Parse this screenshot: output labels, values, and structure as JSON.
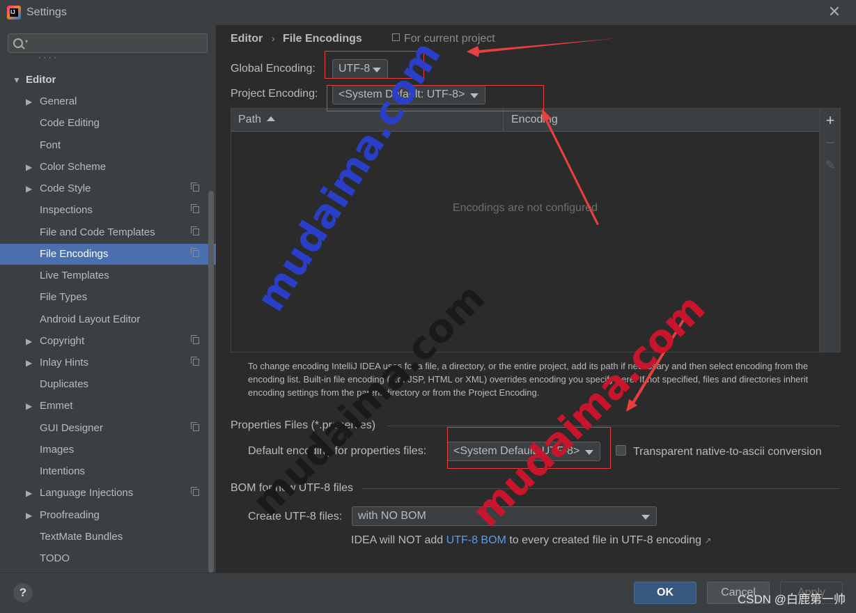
{
  "window": {
    "title": "Settings",
    "close_glyph": "✕"
  },
  "search": {
    "value": "",
    "placeholder": ""
  },
  "sidebar": {
    "partial_item": "· · ·  ·",
    "items": [
      {
        "label": "Editor",
        "level": 0,
        "expand": "open",
        "scoped": false,
        "selected": false
      },
      {
        "label": "General",
        "level": 1,
        "expand": "closed",
        "scoped": false,
        "selected": false
      },
      {
        "label": "Code Editing",
        "level": 1,
        "expand": "none",
        "scoped": false,
        "selected": false
      },
      {
        "label": "Font",
        "level": 1,
        "expand": "none",
        "scoped": false,
        "selected": false
      },
      {
        "label": "Color Scheme",
        "level": 1,
        "expand": "closed",
        "scoped": false,
        "selected": false
      },
      {
        "label": "Code Style",
        "level": 1,
        "expand": "closed",
        "scoped": true,
        "selected": false
      },
      {
        "label": "Inspections",
        "level": 1,
        "expand": "none",
        "scoped": true,
        "selected": false
      },
      {
        "label": "File and Code Templates",
        "level": 1,
        "expand": "none",
        "scoped": true,
        "selected": false
      },
      {
        "label": "File Encodings",
        "level": 1,
        "expand": "none",
        "scoped": true,
        "selected": true
      },
      {
        "label": "Live Templates",
        "level": 1,
        "expand": "none",
        "scoped": false,
        "selected": false
      },
      {
        "label": "File Types",
        "level": 1,
        "expand": "none",
        "scoped": false,
        "selected": false
      },
      {
        "label": "Android Layout Editor",
        "level": 1,
        "expand": "none",
        "scoped": false,
        "selected": false
      },
      {
        "label": "Copyright",
        "level": 1,
        "expand": "closed",
        "scoped": true,
        "selected": false
      },
      {
        "label": "Inlay Hints",
        "level": 1,
        "expand": "closed",
        "scoped": true,
        "selected": false
      },
      {
        "label": "Duplicates",
        "level": 1,
        "expand": "none",
        "scoped": false,
        "selected": false
      },
      {
        "label": "Emmet",
        "level": 1,
        "expand": "closed",
        "scoped": false,
        "selected": false
      },
      {
        "label": "GUI Designer",
        "level": 1,
        "expand": "none",
        "scoped": true,
        "selected": false
      },
      {
        "label": "Images",
        "level": 1,
        "expand": "none",
        "scoped": false,
        "selected": false
      },
      {
        "label": "Intentions",
        "level": 1,
        "expand": "none",
        "scoped": false,
        "selected": false
      },
      {
        "label": "Language Injections",
        "level": 1,
        "expand": "closed",
        "scoped": true,
        "selected": false
      },
      {
        "label": "Proofreading",
        "level": 1,
        "expand": "closed",
        "scoped": false,
        "selected": false
      },
      {
        "label": "TextMate Bundles",
        "level": 1,
        "expand": "none",
        "scoped": false,
        "selected": false
      },
      {
        "label": "TODO",
        "level": 1,
        "expand": "none",
        "scoped": false,
        "selected": false
      }
    ]
  },
  "breadcrumb": {
    "parent": "Editor",
    "separator": "›",
    "current": "File Encodings",
    "scope_label": "For current project"
  },
  "encoding": {
    "global_label": "Global Encoding:",
    "global_value": "UTF-8",
    "project_label": "Project Encoding:",
    "project_value": "<System Default: UTF-8>"
  },
  "table": {
    "columns": [
      "Path",
      "Encoding"
    ],
    "sorted_column": "Path",
    "sort_direction": "ascending",
    "rows": [],
    "empty_text": "Encodings are not configured",
    "tools": {
      "add": "+",
      "remove": "−",
      "edit": "✎"
    }
  },
  "help_text": "To change encoding IntelliJ IDEA uses for a file, a directory, or the entire project, add its path if necessary and then select encoding from the encoding list. Built-in file encoding (e.g. JSP, HTML or XML) overrides encoding you specify here. If not specified, files and directories inherit encoding settings from the parent directory or from the Project Encoding.",
  "properties": {
    "section_title": "Properties Files (*.properties)",
    "default_label": "Default encoding for properties files:",
    "default_value": "<System Default: UTF-8>",
    "native_to_ascii_label": "Transparent native-to-ascii conversion",
    "native_to_ascii_checked": false
  },
  "bom": {
    "section_title": "BOM for new UTF-8 files",
    "create_label": "Create UTF-8 files:",
    "create_value": "with NO BOM",
    "note_prefix": "IDEA will NOT add",
    "note_link": "UTF-8 BOM",
    "note_suffix": "to every created file in UTF-8 encoding",
    "note_ext_glyph": "↗"
  },
  "footer": {
    "help": "?",
    "ok": "OK",
    "cancel": "Cancel",
    "apply": "Apply"
  },
  "overlay": {
    "watermark_text": "mudaima.com",
    "watermark_colors": [
      "#2a3fc8",
      "#1a1a1a",
      "#c9152b"
    ],
    "annotation_color": "#e8403f",
    "credit": "CSDN @白鹿第一帅"
  },
  "colors": {
    "selection": "#4b6eaf",
    "ok_button": "#365880",
    "link": "#589df6"
  }
}
